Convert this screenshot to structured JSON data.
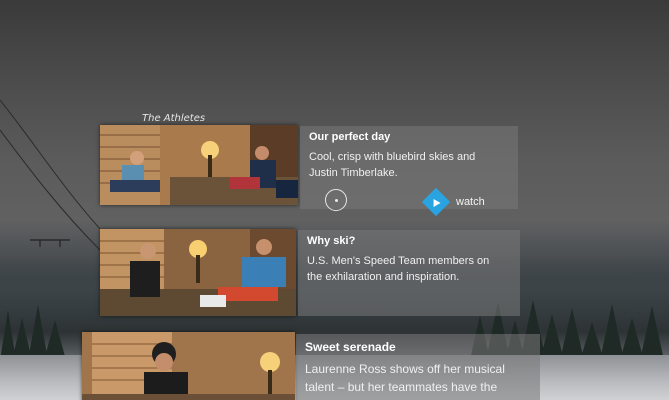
{
  "section_label": "The Athletes",
  "cards": [
    {
      "title": "Our perfect day",
      "description_lines": [
        "Cool, crisp with bluebird skies and",
        "Justin Timberlake."
      ],
      "watch_label": "watch"
    },
    {
      "title": "Why ski?",
      "description_lines": [
        "U.S. Men's Speed Team members on",
        "the exhilaration and inspiration."
      ]
    },
    {
      "title": "Sweet serenade",
      "description_lines": [
        "Laurenne Ross shows off her musical",
        "talent – but her teammates have the"
      ]
    }
  ],
  "colors": {
    "accent": "#2aa4e0",
    "panel": "rgba(120,120,120,0.55)",
    "text": "#f0f0f0"
  },
  "icons": {
    "play": "play-icon",
    "focus": "gaze-cursor-icon"
  }
}
